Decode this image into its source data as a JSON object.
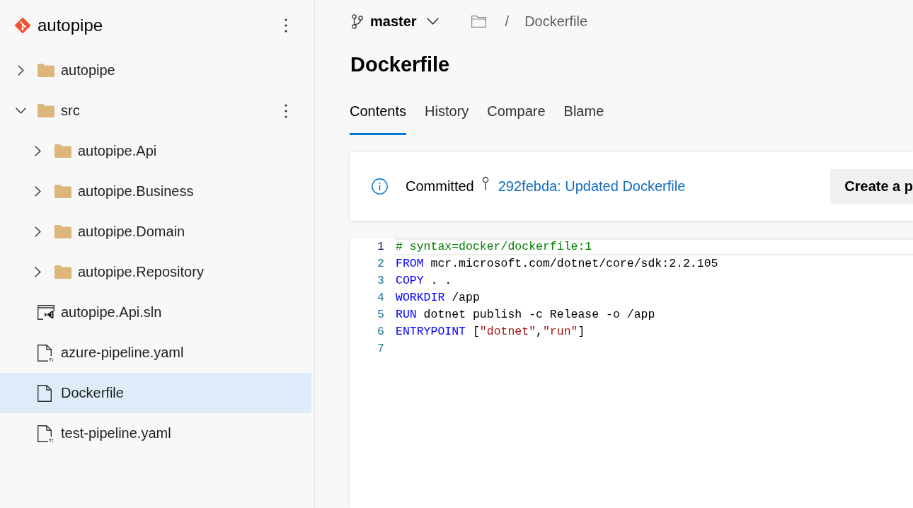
{
  "repo": {
    "name": "autopipe"
  },
  "tree": [
    {
      "kind": "folder",
      "name": "autopipe",
      "expanded": false,
      "selected": false,
      "menu_visible": false
    },
    {
      "kind": "folder",
      "name": "src",
      "expanded": true,
      "selected": false,
      "menu_visible": true,
      "children": [
        {
          "kind": "folder",
          "name": "autopipe.Api",
          "expanded": false,
          "selected": false,
          "menu_visible": false
        },
        {
          "kind": "folder",
          "name": "autopipe.Business",
          "expanded": false,
          "selected": false,
          "menu_visible": false
        },
        {
          "kind": "folder",
          "name": "autopipe.Domain",
          "expanded": false,
          "selected": false,
          "menu_visible": false
        },
        {
          "kind": "folder",
          "name": "autopipe.Repository",
          "expanded": false,
          "selected": false,
          "menu_visible": false
        }
      ]
    },
    {
      "kind": "solution",
      "name": "autopipe.Api.sln",
      "selected": false,
      "menu_visible": false
    },
    {
      "kind": "yaml",
      "name": "azure-pipeline.yaml",
      "selected": false,
      "menu_visible": false
    },
    {
      "kind": "file",
      "name": "Dockerfile",
      "selected": true,
      "menu_visible": false
    },
    {
      "kind": "yaml",
      "name": "test-pipeline.yaml",
      "selected": false,
      "menu_visible": false
    }
  ],
  "branch": {
    "name": "master"
  },
  "breadcrumb": {
    "separator": "/",
    "current": "Dockerfile"
  },
  "title": "Dockerfile",
  "tabs": [
    {
      "label": "Contents",
      "selected": true
    },
    {
      "label": "History",
      "selected": false
    },
    {
      "label": "Compare",
      "selected": false
    },
    {
      "label": "Blame",
      "selected": false
    }
  ],
  "commit_banner": {
    "status": "Committed",
    "link": "292febda: Updated Dockerfile",
    "button": "Create a p"
  },
  "code": {
    "lines": [
      {
        "number": "1",
        "current": true,
        "tokens": [
          {
            "kind": "comment",
            "text": "# syntax=docker/dockerfile:1"
          }
        ]
      },
      {
        "number": "2",
        "current": false,
        "tokens": [
          {
            "kind": "keyword",
            "text": "FROM"
          },
          {
            "kind": "plain",
            "text": " mcr.microsoft.com/dotnet/core/sdk:2.2.105"
          }
        ]
      },
      {
        "number": "3",
        "current": false,
        "tokens": [
          {
            "kind": "keyword",
            "text": "COPY"
          },
          {
            "kind": "plain",
            "text": " . ."
          }
        ]
      },
      {
        "number": "4",
        "current": false,
        "tokens": [
          {
            "kind": "keyword",
            "text": "WORKDIR"
          },
          {
            "kind": "plain",
            "text": " /app"
          }
        ]
      },
      {
        "number": "5",
        "current": false,
        "tokens": [
          {
            "kind": "keyword",
            "text": "RUN"
          },
          {
            "kind": "plain",
            "text": " dotnet publish -c Release -o /app"
          }
        ]
      },
      {
        "number": "6",
        "current": false,
        "tokens": [
          {
            "kind": "keyword",
            "text": "ENTRYPOINT"
          },
          {
            "kind": "plain",
            "text": " ["
          },
          {
            "kind": "string",
            "text": "\"dotnet\""
          },
          {
            "kind": "plain",
            "text": ","
          },
          {
            "kind": "string",
            "text": "\"run\""
          },
          {
            "kind": "plain",
            "text": "]"
          }
        ]
      },
      {
        "number": "7",
        "current": false
      }
    ]
  }
}
